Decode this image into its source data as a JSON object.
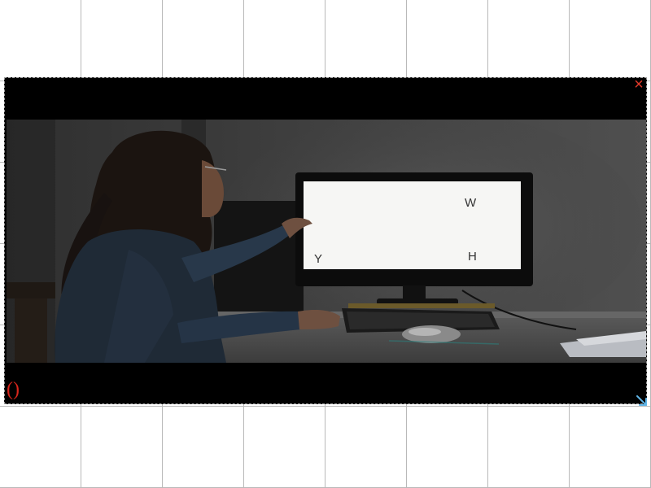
{
  "player": {
    "close_icon": "×",
    "caption_toggle": "()",
    "resize_icon": "resize-arrow"
  },
  "screen_letters": {
    "w": "W",
    "y": "Y",
    "h": "H"
  },
  "colors": {
    "close": "#e23a2a",
    "caption_toggle": "#d8261c",
    "resize": "#5fb4e6"
  }
}
